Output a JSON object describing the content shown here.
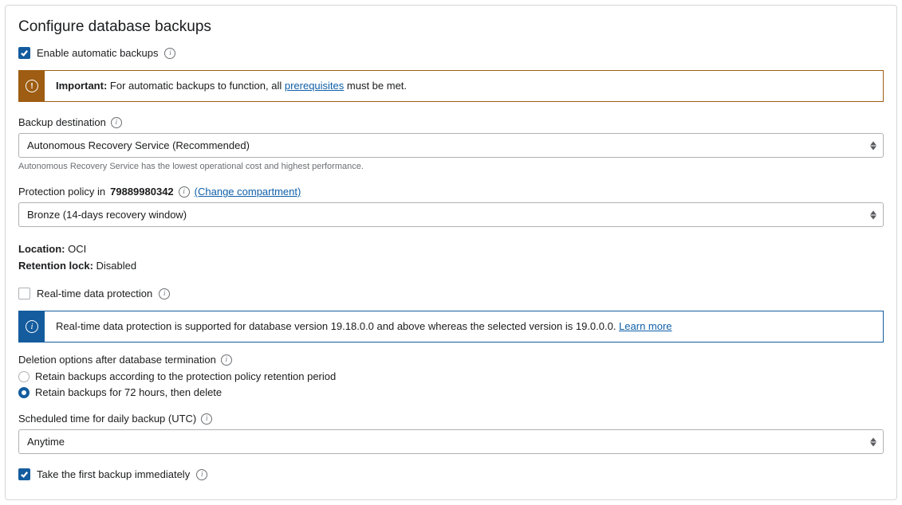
{
  "title": "Configure database backups",
  "enableAutomatic": {
    "label": "Enable automatic backups",
    "checked": true
  },
  "importantAlert": {
    "prefix": "Important:",
    "text_before": " For automatic backups to function, all ",
    "link": "prerequisites",
    "text_after": " must be met."
  },
  "backupDestination": {
    "label": "Backup destination",
    "value": "Autonomous Recovery Service (Recommended)",
    "helper": "Autonomous Recovery Service has the lowest operational cost and highest performance."
  },
  "protectionPolicy": {
    "label_prefix": "Protection policy in ",
    "compartment": "79889980342",
    "change_link": "(Change compartment)",
    "value": "Bronze (14-days recovery window)"
  },
  "location": {
    "label": "Location:",
    "value": "OCI"
  },
  "retentionLock": {
    "label": "Retention lock:",
    "value": "Disabled"
  },
  "realtimeProtection": {
    "label": "Real-time data protection",
    "checked": false
  },
  "infoAlert": {
    "text": "Real-time data protection is supported for database version 19.18.0.0 and above whereas the selected version is 19.0.0.0. ",
    "link": "Learn more"
  },
  "deletionOptions": {
    "label": "Deletion options after database termination",
    "option1": "Retain backups according to the protection policy retention period",
    "option2": "Retain backups for 72 hours, then delete",
    "selected": 2
  },
  "scheduledTime": {
    "label": "Scheduled time for daily backup (UTC)",
    "value": "Anytime"
  },
  "firstBackup": {
    "label": "Take the first backup immediately",
    "checked": true
  }
}
